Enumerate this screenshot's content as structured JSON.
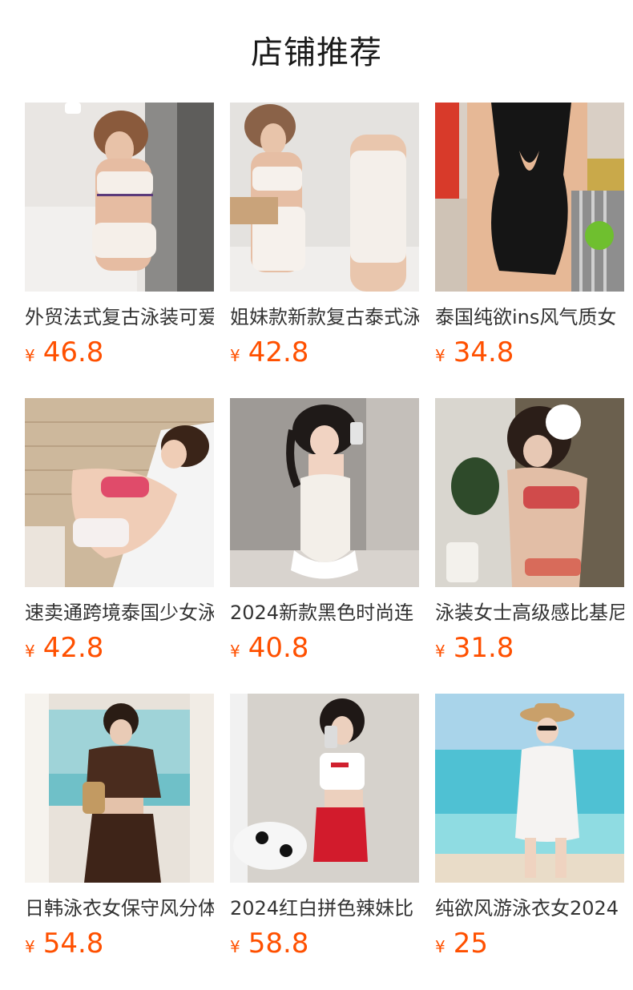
{
  "header": {
    "title": "店铺推荐"
  },
  "currency_symbol": "¥",
  "colors": {
    "price": "#ff5000",
    "title_text": "#333333"
  },
  "products": [
    {
      "title": "外贸法式复古泳装可爱",
      "price": "46.8",
      "image": "product-photo"
    },
    {
      "title": "姐妹款新款复古泰式泳",
      "price": "42.8",
      "image": "product-photo"
    },
    {
      "title": "泰国纯欲ins风气质女",
      "price": "34.8",
      "image": "product-photo"
    },
    {
      "title": "速卖通跨境泰国少女泳",
      "price": "42.8",
      "image": "product-photo"
    },
    {
      "title": "2024新款黑色时尚连",
      "price": "40.8",
      "image": "product-photo"
    },
    {
      "title": "泳装女士高级感比基尼",
      "price": "31.8",
      "image": "product-photo"
    },
    {
      "title": "日韩泳衣女保守风分体",
      "price": "54.8",
      "image": "product-photo"
    },
    {
      "title": "2024红白拼色辣妹比",
      "price": "58.8",
      "image": "product-photo"
    },
    {
      "title": "纯欲风游泳衣女2024",
      "price": "25",
      "image": "product-photo"
    }
  ]
}
